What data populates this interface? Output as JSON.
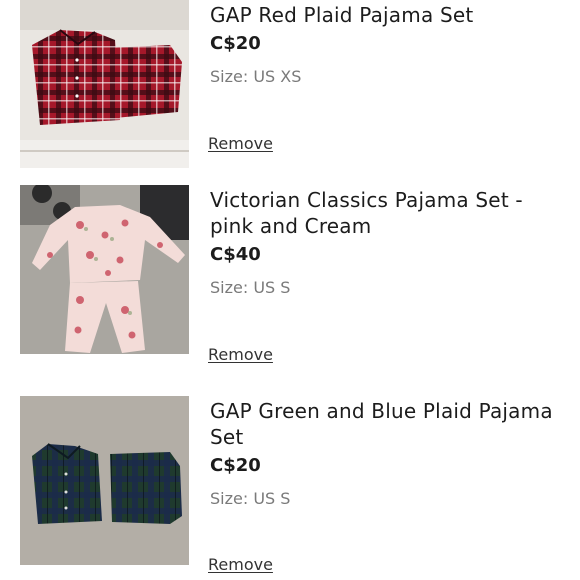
{
  "cart": {
    "items": [
      {
        "title": "GAP Red Plaid Pajama Set",
        "price": "C$20",
        "size": "Size: US XS",
        "remove_label": "Remove"
      },
      {
        "title": "Victorian Classics Pajama Set - pink and Cream",
        "price": "C$40",
        "size": "Size: US S",
        "remove_label": "Remove"
      },
      {
        "title": "GAP Green and Blue Plaid Pajama Set",
        "price": "C$20",
        "size": "Size: US S",
        "remove_label": "Remove"
      }
    ]
  }
}
